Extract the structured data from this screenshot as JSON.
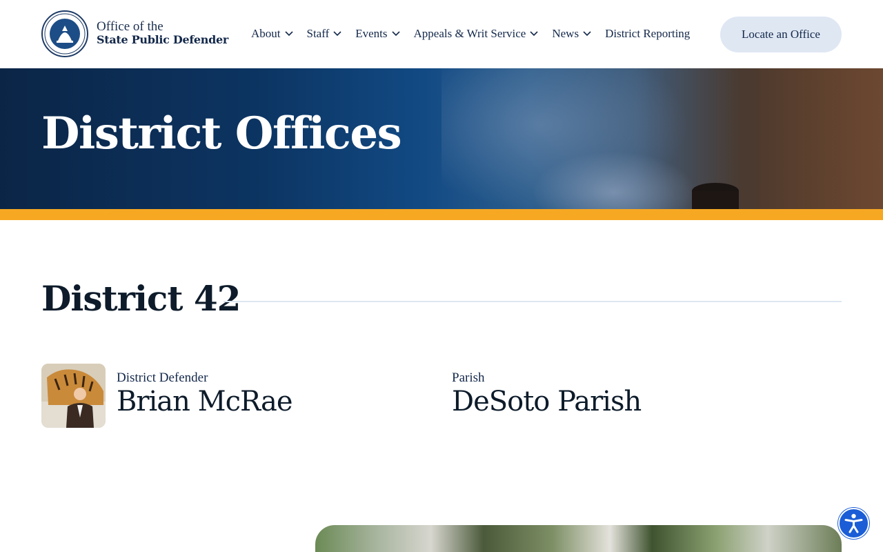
{
  "brand": {
    "line1": "Office of the",
    "line2": "State Public Defender",
    "logo_icon": "louisiana-state-seal-icon"
  },
  "nav": {
    "items": [
      {
        "label": "About",
        "has_dropdown": true
      },
      {
        "label": "Staff",
        "has_dropdown": true
      },
      {
        "label": "Events",
        "has_dropdown": true
      },
      {
        "label": "Appeals & Writ Service",
        "has_dropdown": true
      },
      {
        "label": "News",
        "has_dropdown": true
      },
      {
        "label": "District Reporting",
        "has_dropdown": false
      }
    ],
    "cta_label": "Locate an Office"
  },
  "hero": {
    "title": "District Offices"
  },
  "district": {
    "title": "District 42",
    "defender_label": "District Defender",
    "defender_name": "Brian McRae",
    "parish_label": "Parish",
    "parish_name": "DeSoto Parish"
  },
  "icons": {
    "accessibility": "accessibility-icon",
    "chevron": "chevron-down-icon"
  },
  "colors": {
    "navy": "#13284a",
    "accent_gold": "#f7a823",
    "cta_bg": "#dfe7f3",
    "a11y_blue": "#1a5dd6"
  }
}
